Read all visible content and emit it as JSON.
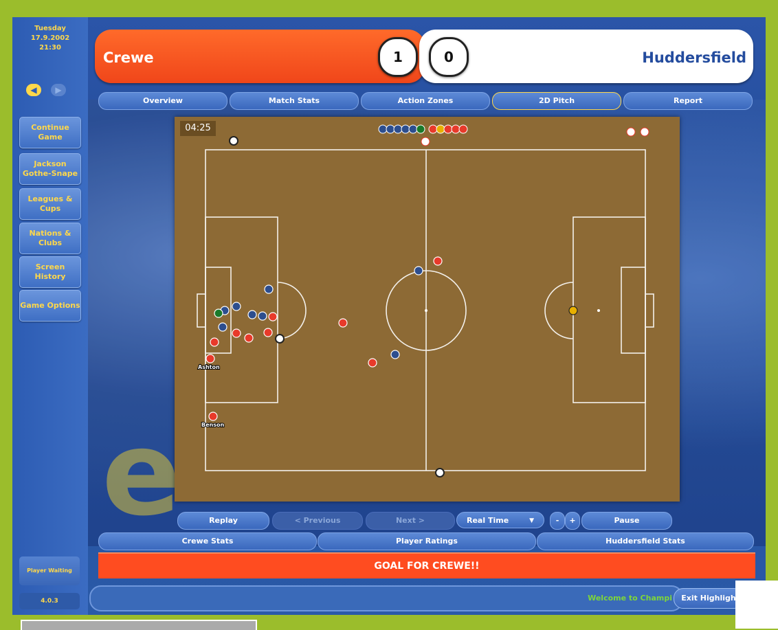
{
  "sidebar": {
    "date": [
      "Tuesday",
      "17.9.2002",
      "21:30"
    ],
    "back_icon": "left-arrow-icon",
    "forward_icon": "right-arrow-icon",
    "buttons": [
      "Continue Game",
      "Jackson Gothe-Snape",
      "Leagues & Cups",
      "Nations & Clubs",
      "Screen History",
      "Game Options"
    ],
    "status": "Player Waiting",
    "version": "4.0.3"
  },
  "match": {
    "home_team": "Crewe",
    "away_team": "Huddersfield",
    "home_score": "1",
    "away_score": "0",
    "home_color": "#f0461a",
    "away_color": "#244c9e"
  },
  "tabs": [
    {
      "label": "Overview",
      "active": false
    },
    {
      "label": "Match Stats",
      "active": false
    },
    {
      "label": "Action Zones",
      "active": false
    },
    {
      "label": "2D Pitch",
      "active": true
    },
    {
      "label": "Report",
      "active": false
    }
  ],
  "pitch": {
    "clock": "04:25",
    "player_labels": {
      "ashton": "Ashton",
      "benson": "Benson"
    }
  },
  "controls": {
    "replay": "Replay",
    "previous": "< Previous",
    "next": "Next >",
    "speed": "Real Time",
    "speed_icon": "dropdown-arrow-icon",
    "minus": "-",
    "plus": "+",
    "pause": "Pause"
  },
  "stats_bar": [
    "Crewe Stats",
    "Player Ratings",
    "Huddersfield Stats"
  ],
  "goal_message": "GOAL FOR CREWE!!",
  "ticker": "Welcome to Champi",
  "exit_button": "Exit Highligh"
}
